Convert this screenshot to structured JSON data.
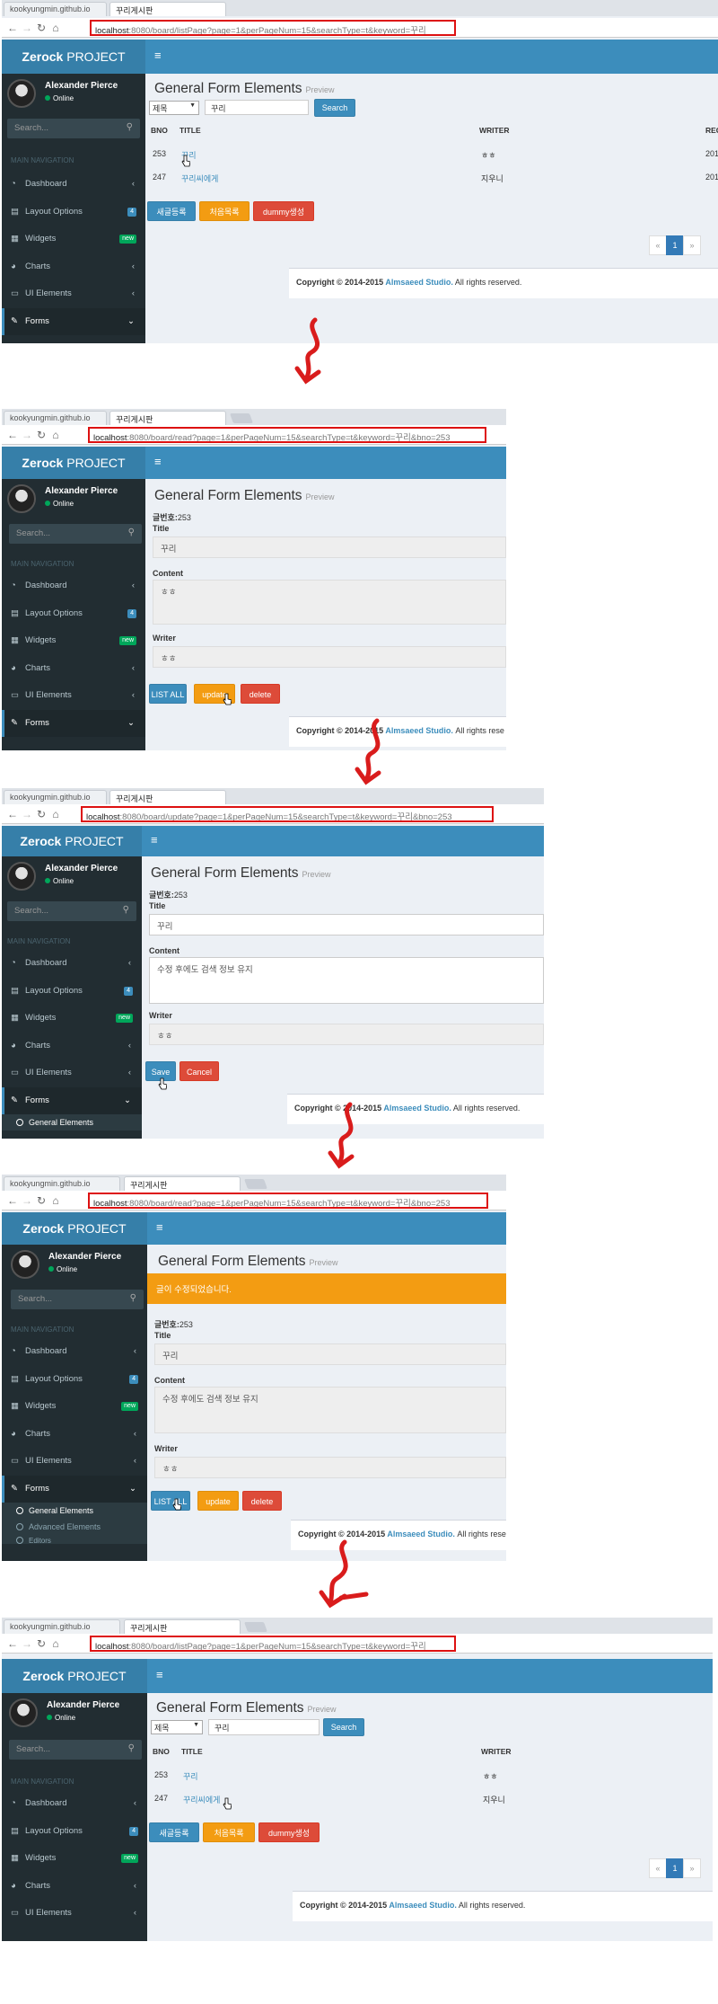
{
  "app": {
    "brand_bold": "Zerock",
    "brand_light": " PROJECT",
    "menu_toggle": "≡",
    "user_name": "Alexander Pierce",
    "user_status": "Online",
    "search_placeholder": "Search...",
    "nav_header": "MAIN NAVIGATION",
    "menu": {
      "dashboard": "Dashboard",
      "layout": "Layout Options",
      "layout_badge": "4",
      "widgets": "Widgets",
      "widgets_badge": "new",
      "charts": "Charts",
      "ui": "UI Elements",
      "forms": "Forms",
      "general": "General Elements",
      "advanced": "Advanced Elements",
      "editors": "Editors"
    },
    "page_title": "General Form Elements",
    "page_subtitle": "Preview",
    "footer_prefix": "Copyright © 2014-2015 ",
    "footer_studio": "Almsaeed Studio.",
    "footer_suffix": " All rights reserved."
  },
  "browser": {
    "tab1": "kookyungmin.github.io",
    "tab2": "꾸리게시판",
    "host": "localhost",
    "list_path": ":8080/board/listPage?page=1&perPageNum=15&searchType=t&keyword=꾸리",
    "read_path": ":8080/board/read?page=1&perPageNum=15&searchType=t&keyword=꾸리&bno=253",
    "update_path": ":8080/board/update?page=1&perPageNum=15&searchType=t&keyword=꾸리&bno=253"
  },
  "list": {
    "search_type": "제목",
    "keyword": "꾸리",
    "search_button": "Search",
    "columns": {
      "bno": "BNO",
      "title": "TITLE",
      "writer": "WRITER",
      "regdate": "REG"
    },
    "rows": [
      {
        "bno": "253",
        "title": "꾸리",
        "writer": "ㅎㅎ",
        "regdate": "201"
      },
      {
        "bno": "247",
        "title": "꾸리씨에게",
        "writer": "지우니",
        "regdate": "201"
      }
    ],
    "new_button": "새글등록",
    "first_button": "처음목록",
    "dummy_button": "dummy생성",
    "pager": {
      "prev": "«",
      "page": "1",
      "next": "»"
    }
  },
  "read": {
    "bno_label": "글번호:",
    "bno": "253",
    "title_label": "Title",
    "title_value": "꾸리",
    "content_label": "Content",
    "content_before": "ㅎㅎ",
    "content_after": "수정 후에도 검색 정보 유지",
    "writer_label": "Writer",
    "writer_value": "ㅎㅎ",
    "list_button": "LIST ALL",
    "update_button": "update",
    "delete_button": "delete",
    "save_button": "Save",
    "cancel_button": "Cancel",
    "alert": "글이 수정되었습니다."
  },
  "footer_trunc": "Copyright © 2014-2015 ",
  "footer_trunc2": "All rights rese",
  "colors": {
    "arrow": "#d91c1c",
    "primary": "#3c8dbc",
    "warning": "#f39c12",
    "danger": "#dd4b39",
    "sidebar": "#222d32"
  }
}
